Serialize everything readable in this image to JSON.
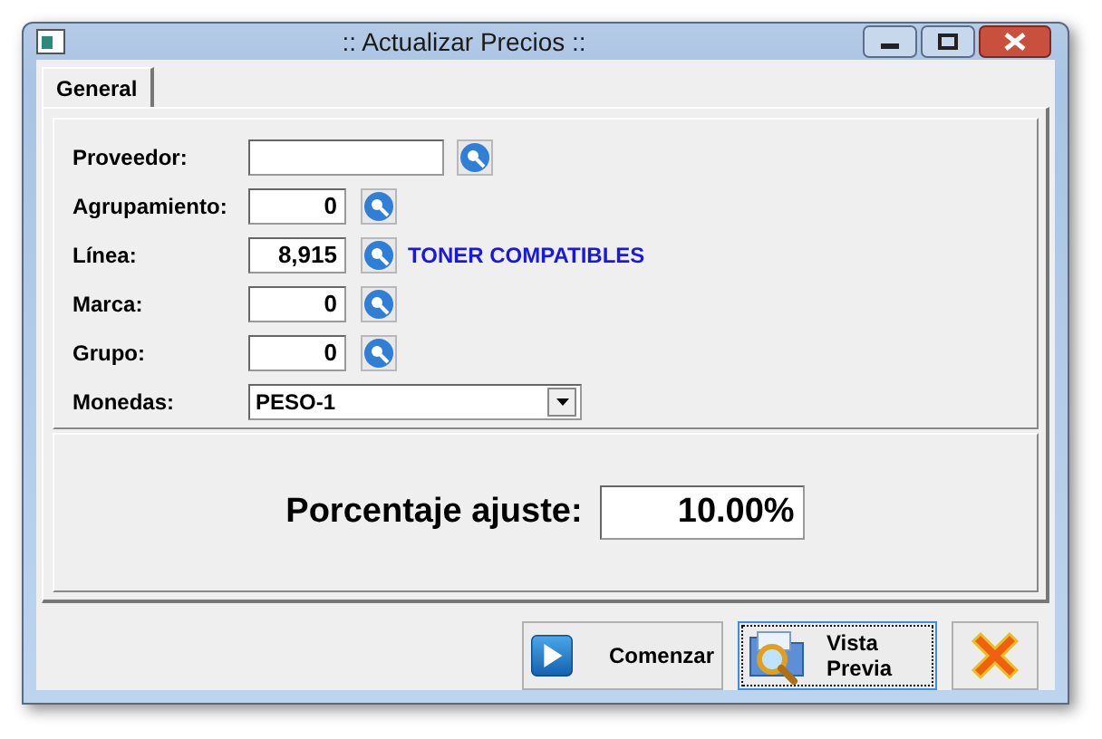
{
  "window": {
    "title": ":: Actualizar Precios ::"
  },
  "tabs": [
    {
      "label": "General",
      "selected": true
    }
  ],
  "fields": [
    {
      "kind": "wide",
      "label": "Proveedor:"
    },
    {
      "kind": "numeric",
      "label": "Agrupamiento:",
      "value": "0"
    },
    {
      "kind": "numeric",
      "label": "Línea:",
      "value": "8,915",
      "description": "TONER COMPATIBLES"
    },
    {
      "kind": "numeric",
      "label": "Marca:",
      "value": "0"
    },
    {
      "kind": "numeric",
      "label": "Grupo:",
      "value": "0"
    },
    {
      "kind": "select",
      "label": "Monedas:",
      "value": "PESO-1"
    }
  ],
  "adjustment": {
    "label": "Porcentaje ajuste:",
    "value": "10.00%"
  },
  "buttons": [
    {
      "kind": "start",
      "label": "Comenzar",
      "focused": false
    },
    {
      "kind": "preview",
      "label": "Vista Previa",
      "focused": true
    },
    {
      "kind": "cancel",
      "focused": false
    }
  ]
}
